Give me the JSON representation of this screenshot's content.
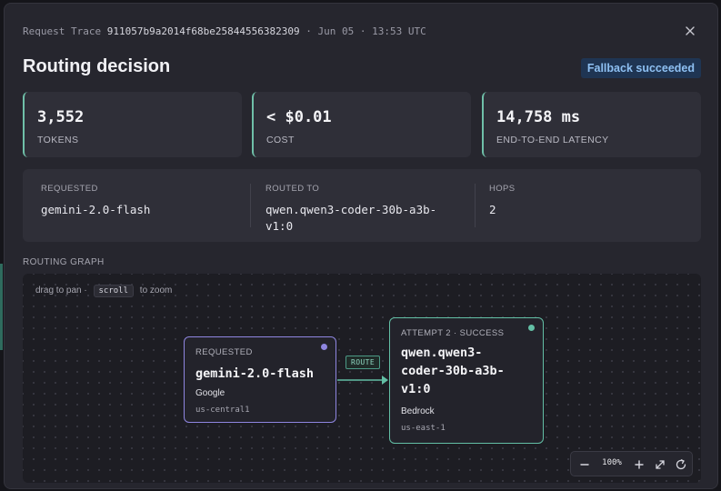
{
  "header": {
    "trace_label": "Request Trace",
    "trace_id": "911057b9a2014f68be25844556382309",
    "separator": "·",
    "date": "Jun 05",
    "time": "13:53 UTC",
    "close_icon": "close-icon",
    "title": "Routing decision",
    "status_badge": "Fallback succeeded"
  },
  "stats": [
    {
      "value": "3,552",
      "label": "TOKENS"
    },
    {
      "value": "< $0.01",
      "label": "COST"
    },
    {
      "value": "14,758 ms",
      "label": "END-TO-END LATENCY"
    }
  ],
  "routing": {
    "requested_label": "REQUESTED",
    "requested_value": "gemini-2.0-flash",
    "routed_label": "ROUTED TO",
    "routed_value_line1": "qwen.qwen3-coder-30b-a3b-",
    "routed_value_line2": "v1:0",
    "hops_label": "HOPS",
    "hops_value": "2"
  },
  "graph": {
    "section_label": "ROUTING GRAPH",
    "hint_prefix": "drag to pan ·",
    "hint_key": "scroll",
    "hint_suffix": "to zoom",
    "edge_label": "ROUTE",
    "nodes": {
      "requested": {
        "kicker": "REQUESTED",
        "model": "gemini-2.0-flash",
        "provider": "Google",
        "region": "us-central1",
        "color": "#8f86e0"
      },
      "attempt": {
        "kicker": "ATTEMPT 2 · SUCCESS",
        "model_line1": "qwen.qwen3-",
        "model_line2": "coder-30b-a3b-",
        "model_line3": "v1:0",
        "provider": "Bedrock",
        "region": "us-east-1",
        "color": "#63bfa5"
      }
    },
    "zoom": {
      "level": "100%",
      "icons": [
        "minus-icon",
        "plus-icon",
        "expand-icon",
        "reset-icon"
      ]
    }
  },
  "colors": {
    "accent_teal": "#6fbfa8",
    "accent_purple": "#8f86e0",
    "badge_bg": "#1f3553",
    "badge_text": "#8ec0f2"
  }
}
